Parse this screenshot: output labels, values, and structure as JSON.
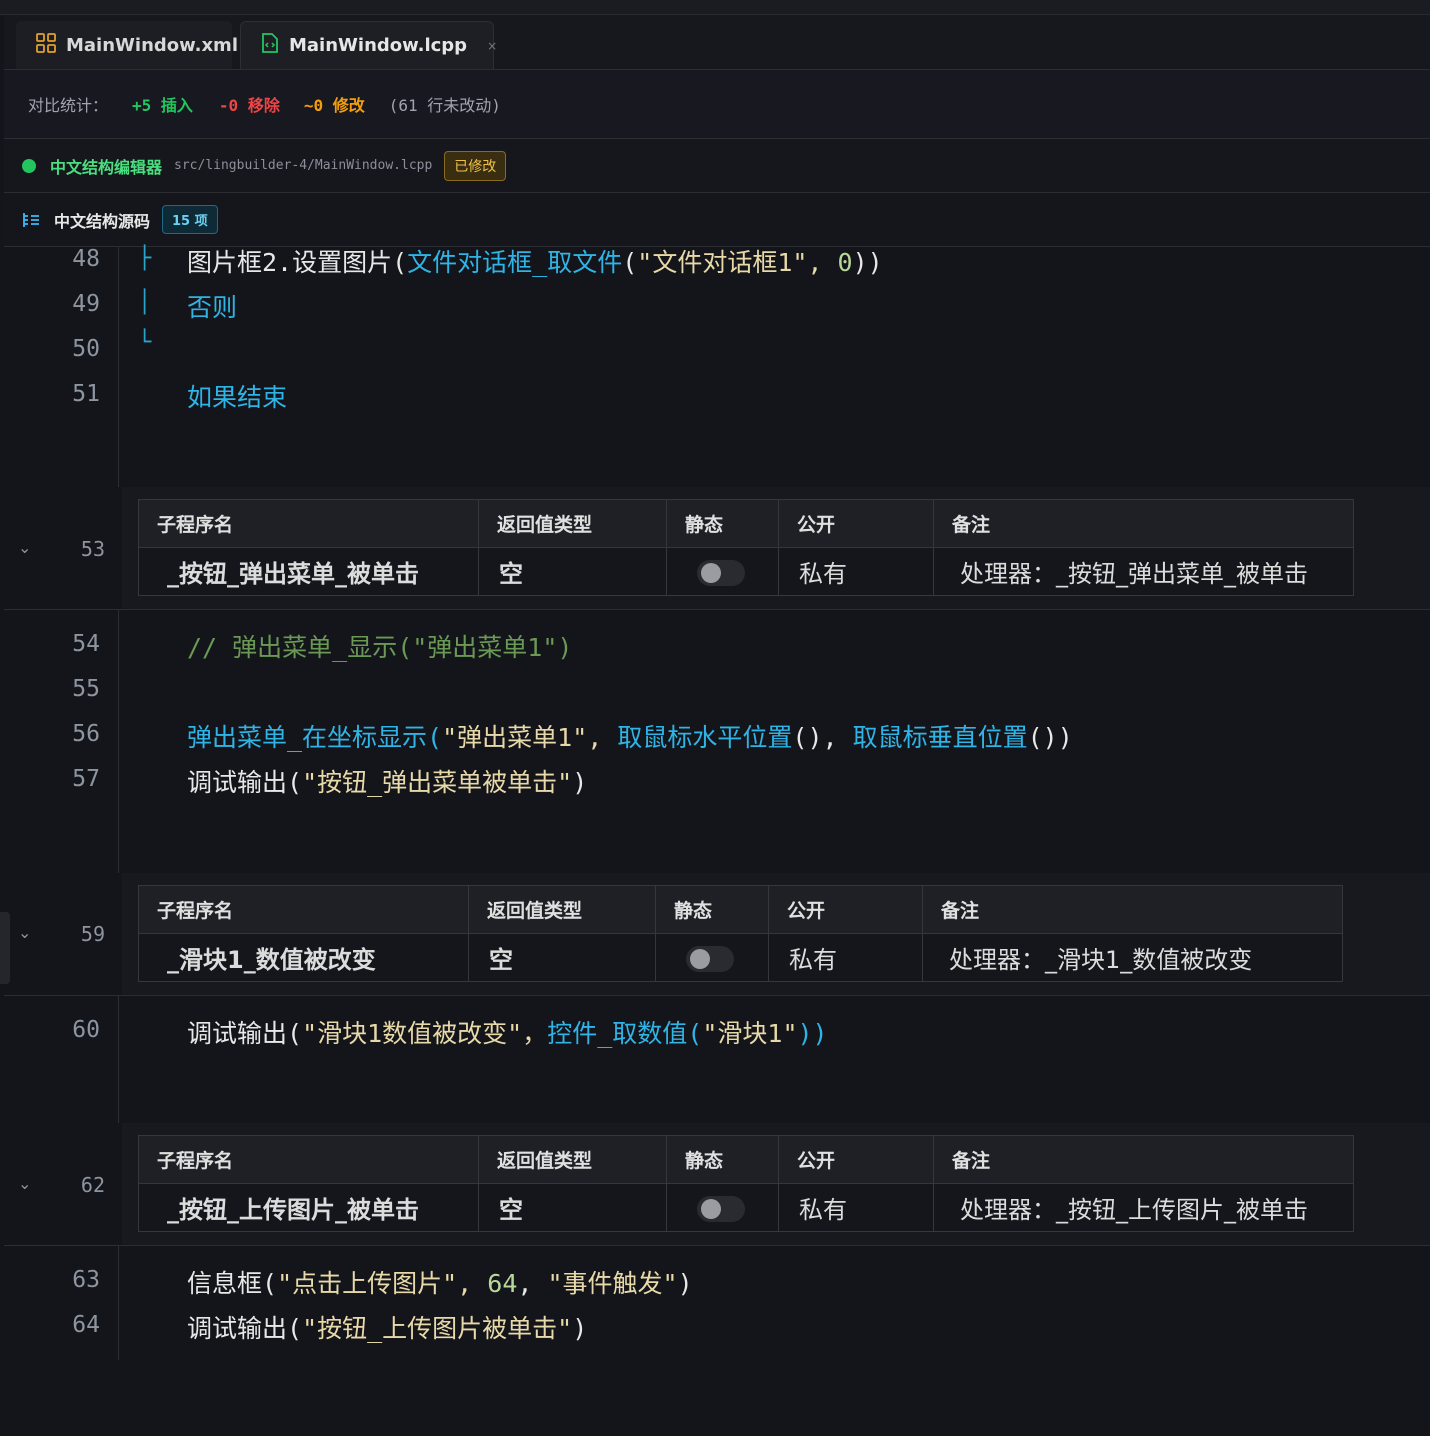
{
  "tabs": [
    {
      "label": "MainWindow.xml"
    },
    {
      "label": "MainWindow.lcpp",
      "close": "×"
    }
  ],
  "stats": {
    "label": "对比统计：",
    "insert": "+5 插入",
    "remove": "-0 移除",
    "modify": "~0 修改",
    "unchanged": "(61 行未改动)"
  },
  "editor": {
    "title": "中文结构编辑器",
    "path": "src/lingbuilder-4/MainWindow.lcpp",
    "badge": "已修改"
  },
  "structure": {
    "title": "中文结构源码",
    "count": "15 项"
  },
  "colors": {
    "background": "#14151b",
    "keyword": "#2eb4e6",
    "string": "#e8d9a8",
    "number": "#b8d89a",
    "comment": "#6a9955",
    "insert": "#22c55e",
    "remove": "#ef4444",
    "modify": "#f59e0b"
  },
  "code": {
    "l48": {
      "num": "48",
      "guide": "├",
      "a": "图片框2.设置图片(",
      "b": "文件对话框_取文件",
      "c": "(",
      "d": "\"文件对话框1\", ",
      "e": "0",
      "f": "))"
    },
    "l49": {
      "num": "49",
      "guide": "│",
      "text": "否则"
    },
    "l50": {
      "num": "50",
      "guide": "└"
    },
    "l51": {
      "num": "51",
      "text": "如果结束"
    },
    "l54": {
      "num": "54",
      "text": "// 弹出菜单_显示(\"弹出菜单1\")"
    },
    "l55": {
      "num": "55"
    },
    "l56": {
      "num": "56",
      "a": "弹出菜单_在坐标显示(",
      "b": "\"弹出菜单1\", ",
      "c": "取鼠标水平位置",
      "d": "(), ",
      "e": "取鼠标垂直位置",
      "f": "())"
    },
    "l57": {
      "num": "57",
      "a": "调试输出(",
      "b": "\"按钮_弹出菜单被单击\"",
      "c": ")"
    },
    "l60": {
      "num": "60",
      "a": "调试输出(",
      "b": "\"滑块1数值被改变\"，",
      "c": "控件_取数值",
      "d": "(",
      "e": "\"滑块1\"",
      "f": "))"
    },
    "l63": {
      "num": "63",
      "a": "信息框(",
      "b": "\"点击上传图片\", ",
      "c": "64",
      "d": ", ",
      "e": "\"事件触发\"",
      "f": ")"
    },
    "l64": {
      "num": "64",
      "a": "调试输出(",
      "b": "\"按钮_上传图片被单击\"",
      "c": ")"
    }
  },
  "table_headers": {
    "name": "子程序名",
    "ret": "返回值类型",
    "static": "静态",
    "public": "公开",
    "note": "备注"
  },
  "subs": [
    {
      "line": "53",
      "name": "_按钮_弹出菜单_被单击",
      "ret": "空",
      "public": "私有",
      "note": "处理器：_按钮_弹出菜单_被单击",
      "static": false
    },
    {
      "line": "59",
      "name": "_滑块1_数值被改变",
      "ret": "空",
      "public": "私有",
      "note": "处理器：_滑块1_数值被改变",
      "static": false
    },
    {
      "line": "62",
      "name": "_按钮_上传图片_被单击",
      "ret": "空",
      "public": "私有",
      "note": "处理器：_按钮_上传图片_被单击",
      "static": false
    }
  ]
}
